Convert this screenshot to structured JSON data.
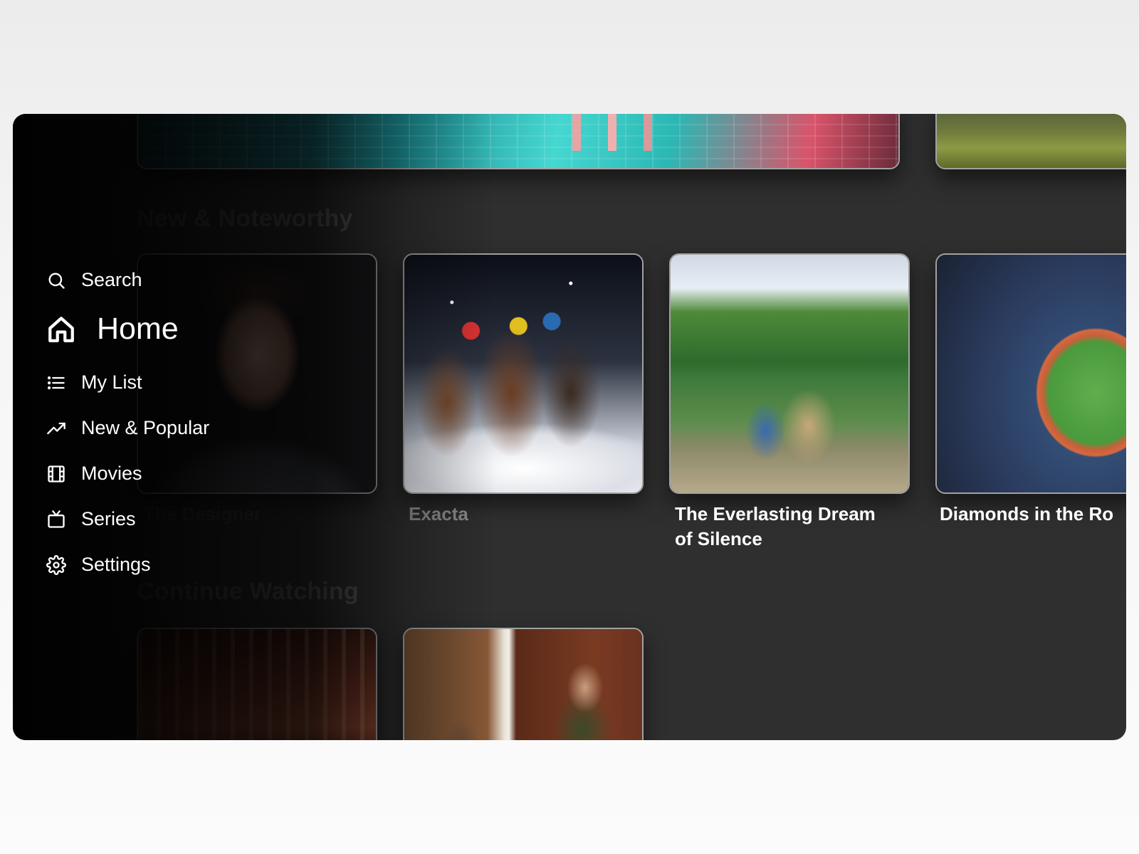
{
  "nav": {
    "items": [
      {
        "label": "Search",
        "icon": "search-icon"
      },
      {
        "label": "Home",
        "icon": "home-icon",
        "active": true
      },
      {
        "label": "My List",
        "icon": "list-icon"
      },
      {
        "label": "New & Popular",
        "icon": "trending-icon"
      },
      {
        "label": "Movies",
        "icon": "film-icon"
      },
      {
        "label": "Series",
        "icon": "tv-icon"
      },
      {
        "label": "Settings",
        "icon": "gear-icon"
      }
    ]
  },
  "rows": {
    "new_noteworthy": {
      "title": "New & Noteworthy",
      "items": [
        {
          "title": "The Designer"
        },
        {
          "title": "Exacta"
        },
        {
          "title_line1": "The Everlasting Dream",
          "title_line2": "of Silence"
        },
        {
          "title": "Diamonds in the Ro"
        }
      ]
    },
    "continue_watching": {
      "title": "Continue Watching"
    }
  },
  "colors": {
    "background": "#2f2f2f",
    "text": "#ffffff",
    "dim_text": "#5a5a5a"
  }
}
